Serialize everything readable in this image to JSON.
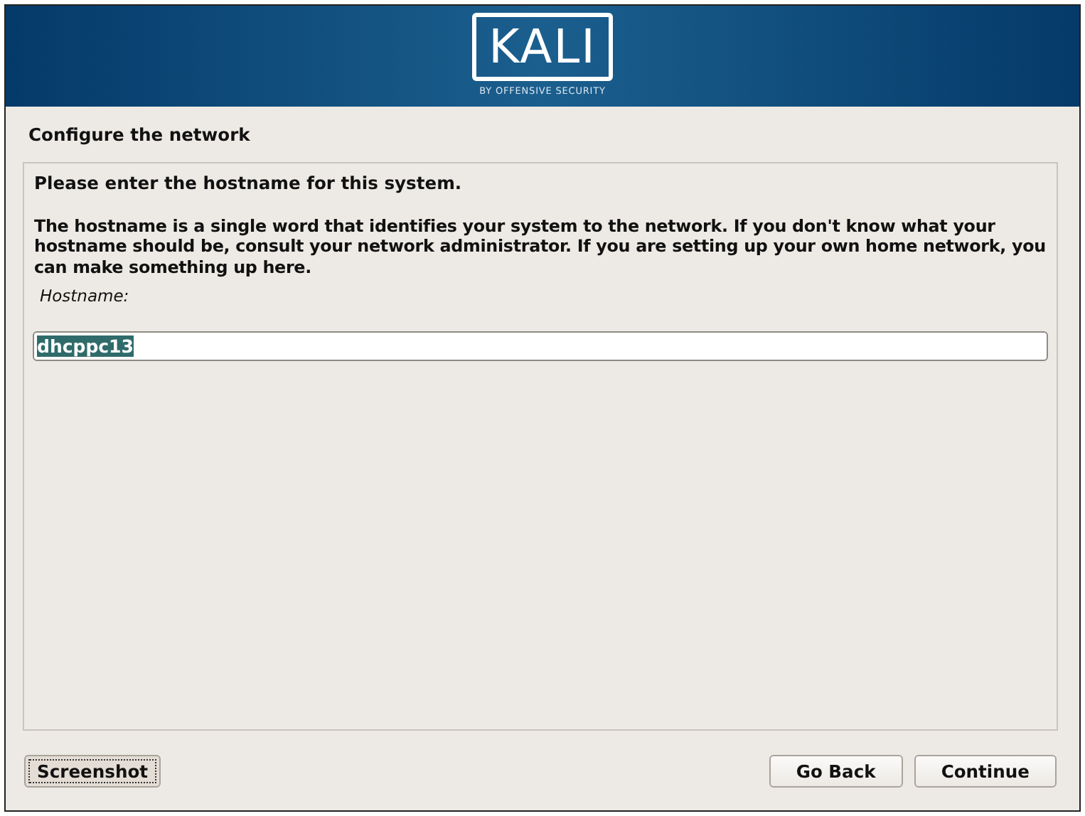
{
  "banner": {
    "logo_text": "KALI",
    "tagline": "BY OFFENSIVE SECURITY"
  },
  "title": "Configure the network",
  "prompt": {
    "heading": "Please enter the hostname for this system.",
    "description": "The hostname is a single word that identifies your system to the network. If you don't know what your hostname should be, consult your network administrator. If you are setting up your own home network, you can make something up here."
  },
  "field": {
    "label": "Hostname:",
    "value": "dhcppc13",
    "value_selected": true
  },
  "buttons": [
    {
      "label": "Screenshot",
      "kind": "left",
      "focused": true
    },
    {
      "label": "Go Back",
      "kind": "right",
      "focused": false
    },
    {
      "label": "Continue",
      "kind": "right",
      "focused": false
    }
  ]
}
